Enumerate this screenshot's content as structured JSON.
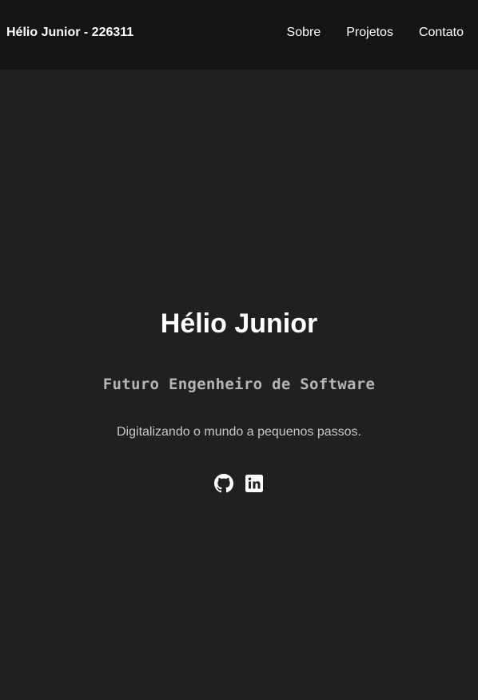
{
  "navbar": {
    "brand": "Hélio Junior - 226311",
    "links": [
      "Sobre",
      "Projetos",
      "Contato"
    ]
  },
  "hero": {
    "name": "Hélio Junior",
    "role": "Futuro Engenheiro de Software",
    "tagline": "Digitalizando o mundo a pequenos passos.",
    "socials": [
      {
        "icon": "github-icon"
      },
      {
        "icon": "linkedin-icon"
      }
    ]
  },
  "colors": {
    "navbar_bg": "#141414",
    "page_bg": "#202020",
    "text": "#ffffff",
    "muted_text": "#b5b5b5"
  }
}
